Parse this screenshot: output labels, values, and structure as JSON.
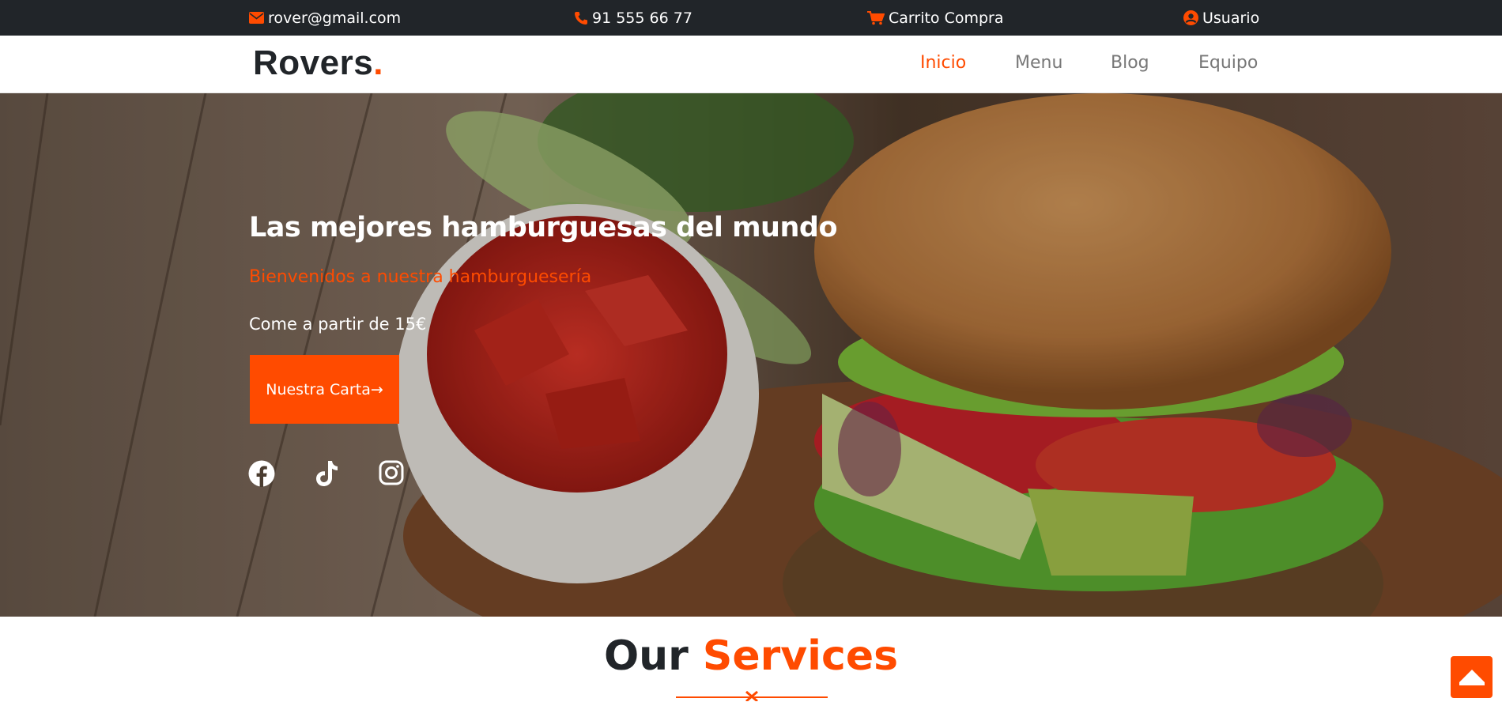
{
  "topbar": {
    "email": "rover@gmail.com",
    "phone": "91 555 66 77",
    "cart": "Carrito Compra",
    "user": "Usuario"
  },
  "navbar": {
    "logo_text": "Rovers",
    "logo_dot": ".",
    "links": [
      {
        "label": "Inicio",
        "active": true
      },
      {
        "label": "Menu",
        "active": false
      },
      {
        "label": "Blog",
        "active": false
      },
      {
        "label": "Equipo",
        "active": false
      }
    ]
  },
  "hero": {
    "title": "Las mejores hamburguesas del mundo",
    "subtitle": "Bienvenidos a nuestra hamburguesería",
    "price_text": "Come a partir de 15€",
    "cta_label": "Nuestra Carta→",
    "social": [
      "facebook-icon",
      "tiktok-icon",
      "instagram-icon"
    ]
  },
  "services": {
    "title_part1": "Our ",
    "title_part2": "Services"
  },
  "colors": {
    "accent": "#ff4b00",
    "dark": "#212529"
  },
  "icons": {
    "email": "envelope-icon",
    "phone": "phone-icon",
    "cart": "cart-icon",
    "user": "user-circle-icon",
    "back_top": "arrow-up-icon"
  }
}
